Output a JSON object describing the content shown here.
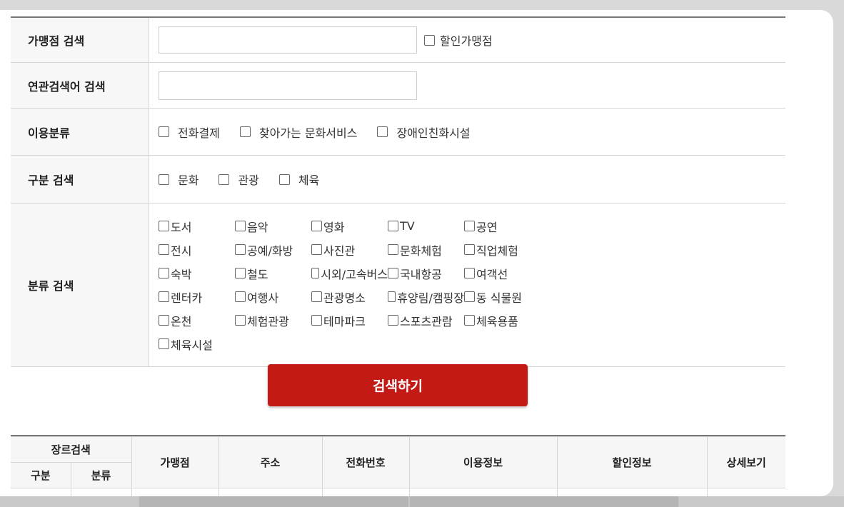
{
  "form": {
    "store_search_label": "가맹점 검색",
    "discount_store_label": "할인가맹점",
    "related_search_label": "연관검색어 검색",
    "usage_label": "이용분류",
    "usage_options": [
      "전화결제",
      "찾아가는 문화서비스",
      "장애인친화시설"
    ],
    "type_label": "구분 검색",
    "type_options": [
      "문화",
      "관광",
      "체육"
    ],
    "category_label": "분류 검색",
    "category_options": [
      "도서",
      "음악",
      "영화",
      "TV",
      "공연",
      "전시",
      "공예/화방",
      "사진관",
      "문화체험",
      "직업체험",
      "숙박",
      "철도",
      "시외/고속버스",
      "국내항공",
      "여객선",
      "렌터카",
      "여행사",
      "관광명소",
      "휴양림/캠핑장",
      "동 식물원",
      "온천",
      "체험관광",
      "테마파크",
      "스포츠관람",
      "체육용품",
      "체육시설"
    ]
  },
  "search_button": "검색하기",
  "table": {
    "genre_search": "장르검색",
    "division": "구분",
    "category": "분류",
    "store": "가맹점",
    "address": "주소",
    "phone": "전화번호",
    "usage_info": "이용정보",
    "discount_info": "할인정보",
    "details": "상세보기"
  }
}
